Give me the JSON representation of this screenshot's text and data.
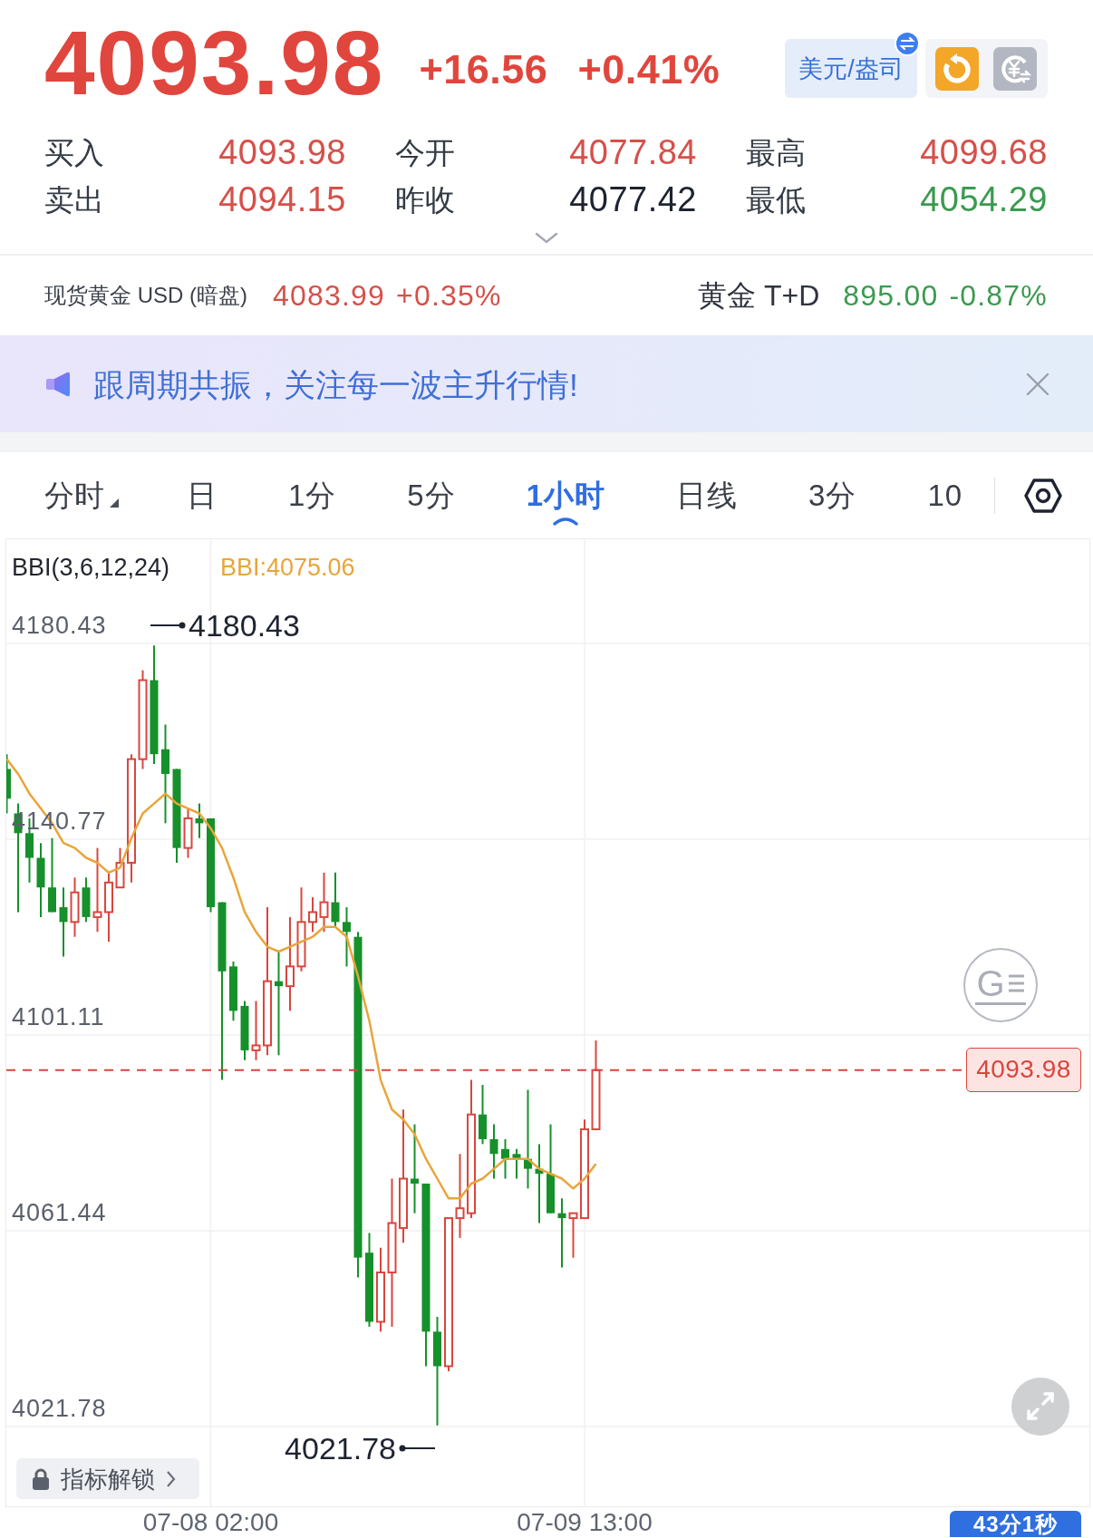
{
  "quote": {
    "price": "4093.98",
    "change": "+16.56",
    "change_pct": "+0.41%",
    "color": "#e0463d"
  },
  "unit_toggle": {
    "label": "美元/盎司"
  },
  "stats": [
    {
      "label": "买入",
      "value": "4093.98",
      "color": "#d5504a"
    },
    {
      "label": "今开",
      "value": "4077.84",
      "color": "#d5504a"
    },
    {
      "label": "最高",
      "value": "4099.68",
      "color": "#d5504a"
    },
    {
      "label": "卖出",
      "value": "4094.15",
      "color": "#d5504a"
    },
    {
      "label": "昨收",
      "value": "4077.42",
      "color": "#1e2331"
    },
    {
      "label": "最低",
      "value": "4054.29",
      "color": "#3b9a4f"
    }
  ],
  "related": [
    {
      "name": "现货黄金 USD (暗盘)",
      "price": "4083.99",
      "change_pct": "+0.35%",
      "color": "#d5504a"
    },
    {
      "name": "黄金 T+D",
      "price": "895.00",
      "change_pct": "-0.87%",
      "color": "#3b9a4f"
    }
  ],
  "banner": {
    "text": "跟周期共振，关注每一波主升行情!"
  },
  "tabs": [
    {
      "label": "分时",
      "kind": "menu",
      "selected": false
    },
    {
      "label": "日",
      "kind": "plain",
      "selected": false
    },
    {
      "label": "1分",
      "kind": "plain",
      "selected": false
    },
    {
      "label": "5分",
      "kind": "plain",
      "selected": false
    },
    {
      "label": "1小时",
      "kind": "plain",
      "selected": true
    },
    {
      "label": "日线",
      "kind": "plain",
      "selected": false
    },
    {
      "label": "3分",
      "kind": "plain",
      "selected": false
    },
    {
      "label": "10",
      "kind": "plain",
      "selected": false
    }
  ],
  "chart": {
    "indicator": "BBI(3,6,12,24)",
    "high_label": "4180.43",
    "low_label": "4021.78",
    "float_button": "G",
    "unlock_button": "指标解锁",
    "timer": "43分1秒",
    "chart_data": {
      "type": "candlestick",
      "categories": [
        null,
        null,
        null,
        null,
        null,
        null,
        null,
        null,
        null,
        null,
        null,
        null,
        null,
        null,
        null,
        null,
        null,
        null,
        "07-08 02:00",
        null,
        null,
        null,
        null,
        null,
        null,
        null,
        null,
        null,
        null,
        null,
        null,
        null,
        null,
        null,
        null,
        null,
        null,
        null,
        null,
        null,
        null,
        null,
        null,
        null,
        null,
        null,
        null,
        null,
        null,
        null,
        null,
        "07-09 13:00",
        null
      ],
      "ohlc": [
        [
          4155,
          4158,
          4146,
          4149
        ],
        [
          4146,
          4148,
          4126,
          4142
        ],
        [
          4142,
          4145,
          4132,
          4137
        ],
        [
          4137,
          4140,
          4125,
          4131
        ],
        [
          4131,
          4141,
          4126,
          4126
        ],
        [
          4127,
          4131,
          4117,
          4124
        ],
        [
          4124,
          4133,
          4121,
          4130
        ],
        [
          4131,
          4133,
          4124,
          4125
        ],
        [
          4125,
          4139,
          4122,
          4126
        ],
        [
          4126,
          4134,
          4120,
          4132
        ],
        [
          4131,
          4139,
          4131,
          4136
        ],
        [
          4136,
          4158,
          4132,
          4157
        ],
        [
          4157,
          4175,
          4155,
          4173
        ],
        [
          4173,
          4180,
          4156,
          4158
        ],
        [
          4159,
          4164,
          4144,
          4154
        ],
        [
          4155,
          4155,
          4136,
          4139
        ],
        [
          4139,
          4147,
          4137,
          4145
        ],
        [
          4145,
          4148,
          4141,
          4144
        ],
        [
          4145,
          4145,
          4126,
          4127
        ],
        [
          4128,
          4128,
          4092,
          4114
        ],
        [
          4115,
          4116,
          4104,
          4106
        ],
        [
          4107,
          4108,
          4096,
          4098
        ],
        [
          4098,
          4108,
          4096,
          4099
        ],
        [
          4099,
          4127,
          4097,
          4112
        ],
        [
          4112,
          4118,
          4097,
          4111
        ],
        [
          4111,
          4125,
          4106,
          4115
        ],
        [
          4115,
          4131,
          4114,
          4124
        ],
        [
          4124,
          4129,
          4122,
          4126
        ],
        [
          4125,
          4134,
          4122,
          4128
        ],
        [
          4128,
          4134,
          4123,
          4124
        ],
        [
          4124,
          4127,
          4115,
          4122
        ],
        [
          4121,
          4122,
          4052,
          4056
        ],
        [
          4057,
          4061,
          4042,
          4043
        ],
        [
          4043,
          4058,
          4041,
          4053
        ],
        [
          4053,
          4072,
          4042,
          4063
        ],
        [
          4062,
          4086,
          4059,
          4072
        ],
        [
          4072,
          4083,
          4065,
          4071
        ],
        [
          4071,
          4071,
          4034,
          4041
        ],
        [
          4041,
          4044,
          4022,
          4034
        ],
        [
          4034,
          4064,
          4033,
          4064
        ],
        [
          4064,
          4077,
          4060,
          4066
        ],
        [
          4065,
          4092,
          4064,
          4085
        ],
        [
          4085,
          4091,
          4079,
          4080
        ],
        [
          4080,
          4083,
          4072,
          4077
        ],
        [
          4078,
          4080,
          4072,
          4076
        ],
        [
          4077,
          4078,
          4072,
          4076
        ],
        [
          4076,
          4090,
          4070,
          4074
        ],
        [
          4074,
          4079,
          4063,
          4073
        ],
        [
          4073,
          4083,
          4065,
          4065
        ],
        [
          4065,
          4068,
          4054,
          4064
        ],
        [
          4064,
          4065,
          4056,
          4065
        ],
        [
          4064,
          4084,
          4064,
          4082
        ],
        [
          4082,
          4100,
          4082,
          4094
        ]
      ],
      "series": [
        {
          "name": "BBI:4075.06",
          "type": "line",
          "color": "#e8a53a",
          "values": [
            4157,
            4154,
            4150,
            4147,
            4144,
            4140,
            4139,
            4137,
            4136,
            4134,
            4135,
            4141,
            4146,
            4148,
            4150,
            4148,
            4147,
            4146,
            4143,
            4139,
            4133,
            4126,
            4122,
            4119,
            4118,
            4119,
            4120,
            4121,
            4123,
            4123,
            4121,
            4113,
            4104,
            4092,
            4086,
            4084,
            4081,
            4076,
            4072,
            4068,
            4068,
            4071,
            4072,
            4074,
            4076,
            4076,
            4076,
            4074,
            4073,
            4072,
            4070,
            4072,
            4075
          ]
        }
      ],
      "ref_lines": [
        {
          "axis": "y",
          "value": 4093.98,
          "label": "4093.98",
          "color": "#d9463e"
        }
      ],
      "grid": true,
      "ylim": [
        4005.62,
        4201.55
      ],
      "yticks": [
        {
          "value": 4180.43,
          "label": "4180.43"
        },
        {
          "value": 4140.77,
          "label": "4140.77"
        },
        {
          "value": 4101.11,
          "label": "4101.11"
        },
        {
          "value": 4061.44,
          "label": "4061.44"
        },
        {
          "value": 4021.78,
          "label": "4021.78"
        }
      ]
    }
  }
}
